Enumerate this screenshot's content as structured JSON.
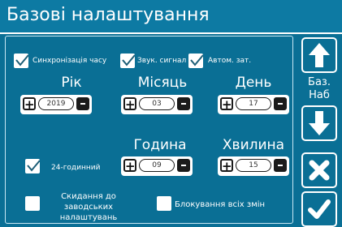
{
  "window": {
    "title": "Базові налаштування"
  },
  "options": {
    "time_sync": {
      "label": "Синхронізація часу",
      "checked": true
    },
    "beep": {
      "label": "Звук. сигнал",
      "checked": true
    },
    "auto_off": {
      "label": "Автом. зат.",
      "checked": true
    },
    "hour_24": {
      "label": "24-годинний",
      "checked": true
    },
    "factory_reset": {
      "label": "Скидання до\nзаводських\nналаштувань",
      "checked": false
    },
    "lock_changes": {
      "label": "Блокування всіх змін",
      "checked": false
    }
  },
  "date": {
    "year": {
      "label": "Рік",
      "value": "2019"
    },
    "month": {
      "label": "Місяць",
      "value": "03"
    },
    "day": {
      "label": "День",
      "value": "17"
    }
  },
  "time": {
    "hour": {
      "label": "Година",
      "value": "09"
    },
    "minute": {
      "label": "Хвилина",
      "value": "15"
    }
  },
  "side_panel": {
    "page_label_line1": "Баз.",
    "page_label_line2": "Наб",
    "icons": [
      "arrow-up-icon",
      "arrow-down-icon",
      "close-icon",
      "check-icon"
    ]
  },
  "colors": {
    "background": "#0a6f95",
    "title_bar": "#0d7aa3",
    "foreground": "#ffffff",
    "control_dark": "#1b1b1b"
  }
}
